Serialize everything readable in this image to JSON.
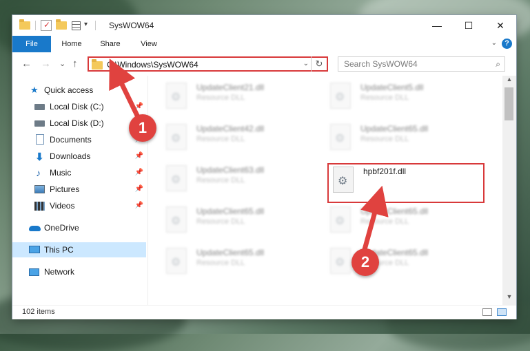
{
  "window": {
    "title": "SysWOW64",
    "qat_check": "✓",
    "qat_dropdown": "▾",
    "minimize": "—",
    "maximize": "☐",
    "close": "✕"
  },
  "ribbon": {
    "tabs": [
      {
        "label": "File"
      },
      {
        "label": "Home"
      },
      {
        "label": "Share"
      },
      {
        "label": "View"
      }
    ],
    "expand": "⌄",
    "help": "?"
  },
  "nav": {
    "back": "←",
    "forward": "→",
    "recent": "⌄",
    "up": "↑",
    "address": "C:\\Windows\\SysWOW64",
    "address_dropdown": "⌄",
    "refresh": "↻",
    "search_placeholder": "Search SysWOW64",
    "search_icon": "⌕"
  },
  "sidebar": {
    "pin_glyph": "📌",
    "items": [
      {
        "label": "Quick access",
        "icon": "star-icon"
      },
      {
        "label": "Local Disk (C:)",
        "icon": "drive-icon",
        "pinned": true
      },
      {
        "label": "Local Disk (D:)",
        "icon": "drive-icon"
      },
      {
        "label": "Documents",
        "icon": "documents-icon",
        "pinned": true
      },
      {
        "label": "Downloads",
        "icon": "download-icon",
        "pinned": true
      },
      {
        "label": "Music",
        "icon": "music-icon",
        "pinned": true
      },
      {
        "label": "Pictures",
        "icon": "pictures-icon",
        "pinned": true
      },
      {
        "label": "Videos",
        "icon": "videos-icon",
        "pinned": true
      },
      {
        "label": "OneDrive",
        "icon": "cloud-icon"
      },
      {
        "label": "This PC",
        "icon": "computer-icon",
        "selected": true
      },
      {
        "label": "Network",
        "icon": "network-icon"
      }
    ]
  },
  "files": [
    {
      "name": "UpdateClient21.dll",
      "type": "Resource DLL"
    },
    {
      "name": "UpdateClient5.dll",
      "type": "Resource DLL"
    },
    {
      "name": "UpdateClient42.dll",
      "type": "Resource DLL"
    },
    {
      "name": "UpdateClient65.dll",
      "type": "Resource DLL"
    },
    {
      "name": "UpdateClient63.dll",
      "type": "Resource DLL"
    },
    {
      "name": "hpbf201f.dll",
      "type": ""
    },
    {
      "name": "UpdateClient65.dll",
      "type": "Resource DLL"
    },
    {
      "name": "UpdateClient65.dll",
      "type": "Resource DLL"
    },
    {
      "name": "UpdateClient65.dll",
      "type": "Resource DLL"
    },
    {
      "name": "UpdateClient65.dll",
      "type": "Resource DLL"
    }
  ],
  "scrollbar": {
    "up": "▲",
    "down": "▼"
  },
  "status": {
    "item_count": "102 items"
  },
  "annotations": {
    "step1": "1",
    "step2": "2"
  },
  "colors": {
    "accent": "#1979ca",
    "highlight": "#d8393a",
    "selected": "#cce8ff"
  }
}
